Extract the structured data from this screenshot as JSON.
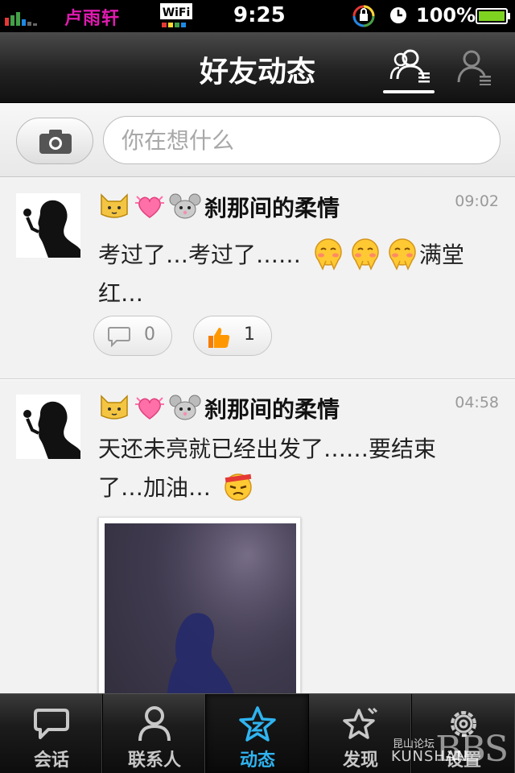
{
  "status_bar": {
    "carrier": "卢雨轩",
    "wifi_label": "WiFi",
    "time": "9:25",
    "battery": "100%"
  },
  "nav": {
    "title": "好友动态",
    "friends_icon": "friends-feed-icon",
    "me_icon": "my-feed-icon"
  },
  "compose": {
    "camera_icon": "camera-icon",
    "placeholder": "你在想什么"
  },
  "posts": [
    {
      "name": "刹那间的柔情",
      "name_emojis": [
        "cat-face",
        "heart",
        "mouse-face"
      ],
      "time": "09:02",
      "text_before": "考过了…考过了……",
      "text_after": "满堂红…",
      "inline_emojis": [
        "blushing-face",
        "blushing-face",
        "blushing-face"
      ],
      "comments": "0",
      "likes": "1"
    },
    {
      "name": "刹那间的柔情",
      "name_emojis": [
        "cat-face",
        "heart",
        "mouse-face"
      ],
      "time": "04:58",
      "text": "天还未亮就已经出发了……要结束了…加油…",
      "inline_emojis": [
        "determined-face"
      ],
      "has_photo": true
    }
  ],
  "tabs": [
    {
      "label": "会话",
      "icon": "chat-bubble-icon",
      "active": false
    },
    {
      "label": "联系人",
      "icon": "contact-icon",
      "active": false
    },
    {
      "label": "动态",
      "icon": "star-icon",
      "active": true
    },
    {
      "label": "发现",
      "icon": "discover-icon",
      "active": false
    },
    {
      "label": "设置",
      "icon": "gear-icon",
      "active": false
    }
  ],
  "watermark": {
    "top": "昆山论坛",
    "bottom": "KUNSHAN",
    "brand": "BBS"
  },
  "colors": {
    "active_tab": "#2fb4f0",
    "carrier": "#e01bb0"
  }
}
